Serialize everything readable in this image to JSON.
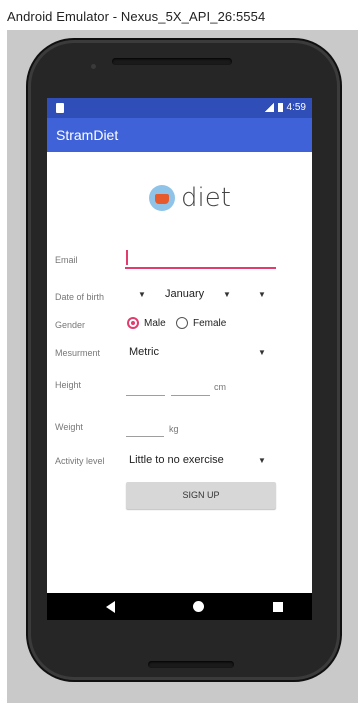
{
  "window": {
    "title": "Android Emulator - Nexus_5X_API_26:5554"
  },
  "status_bar": {
    "time": "4:59"
  },
  "app_bar": {
    "title": "StramDiet"
  },
  "logo": {
    "text": "diet"
  },
  "form": {
    "email_label": "Email",
    "email_value": "",
    "dob_label": "Date of birth",
    "dob_day": "",
    "dob_month": "January",
    "dob_year": "",
    "gender_label": "Gender",
    "gender_options": [
      {
        "label": "Male",
        "selected": true
      },
      {
        "label": "Female",
        "selected": false
      }
    ],
    "measurement_label": "Mesurment",
    "measurement_value": "Metric",
    "height_label": "Height",
    "height_unit": "cm",
    "weight_label": "Weight",
    "weight_unit": "kg",
    "activity_label": "Activity level",
    "activity_value": "Little to no exercise",
    "signup_label": "SIGN UP"
  },
  "colors": {
    "status_bar": "#2f4eb8",
    "app_bar": "#3f62d8",
    "accent": "#e23b6e"
  }
}
